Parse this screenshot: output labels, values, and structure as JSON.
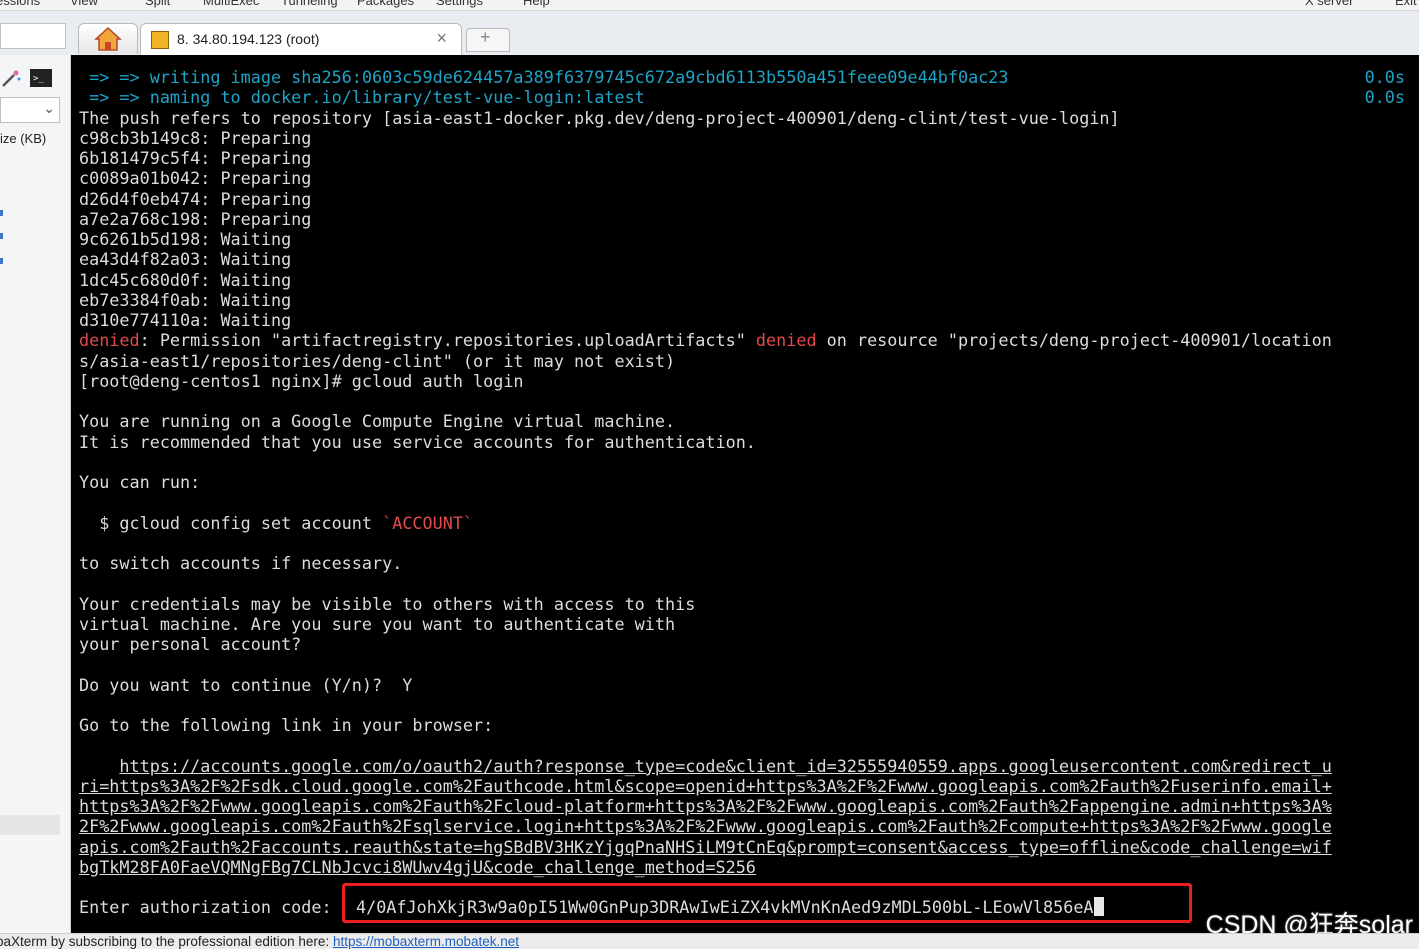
{
  "menu": {
    "items": [
      "essions",
      "View",
      "Split",
      "MultiExec",
      "Tunneling",
      "Packages",
      "Settings",
      "Help"
    ],
    "right_items": [
      "X server",
      "Exit"
    ]
  },
  "tabs": {
    "home_icon": "home-icon",
    "session_title": "8. 34.80.194.123 (root)",
    "close_glyph": "×",
    "new_tab_glyph": "+"
  },
  "sidebar": {
    "column_header": "ize (KB)"
  },
  "terminal": {
    "lines": [
      {
        "cls": "cyan",
        "text": " => => writing image sha256:0603c59de624457a389f6379745c672a9cbd6113b550a451feee09e44bf0ac23"
      },
      {
        "cls": "cyan",
        "text": " => => naming to docker.io/library/test-vue-login:latest"
      },
      {
        "cls": "",
        "text": "The push refers to repository [asia-east1-docker.pkg.dev/deng-project-400901/deng-clint/test-vue-login]"
      },
      {
        "cls": "",
        "text": "c98cb3b149c8: Preparing"
      },
      {
        "cls": "",
        "text": "6b181479c5f4: Preparing"
      },
      {
        "cls": "",
        "text": "c0089a01b042: Preparing"
      },
      {
        "cls": "",
        "text": "d26d4f0eb474: Preparing"
      },
      {
        "cls": "",
        "text": "a7e2a768c198: Preparing"
      },
      {
        "cls": "",
        "text": "9c6261b5d198: Waiting"
      },
      {
        "cls": "",
        "text": "ea43d4f82a03: Waiting"
      },
      {
        "cls": "",
        "text": "1dc45c680d0f: Waiting"
      },
      {
        "cls": "",
        "text": "eb7e3384f0ab: Waiting"
      },
      {
        "cls": "",
        "text": "d310e774110a: Waiting"
      },
      {
        "cls": "denied",
        "text": ": Permission \"artifactregistry.repositories.uploadArtifacts\" ",
        "tail": " on resource \"projects/deng-project-400901/location"
      },
      {
        "cls": "",
        "text": "s/asia-east1/repositories/deng-clint\" (or it may not exist)"
      },
      {
        "cls": "",
        "text": "[root@deng-centos1 nginx]# gcloud auth login"
      },
      {
        "cls": "",
        "text": ""
      },
      {
        "cls": "",
        "text": "You are running on a Google Compute Engine virtual machine."
      },
      {
        "cls": "",
        "text": "It is recommended that you use service accounts for authentication."
      },
      {
        "cls": "",
        "text": ""
      },
      {
        "cls": "",
        "text": "You can run:"
      },
      {
        "cls": "",
        "text": ""
      },
      {
        "cls": "account",
        "text": "  $ gcloud config set account ",
        "tail": "`ACCOUNT`"
      },
      {
        "cls": "",
        "text": ""
      },
      {
        "cls": "",
        "text": "to switch accounts if necessary."
      },
      {
        "cls": "",
        "text": ""
      },
      {
        "cls": "",
        "text": "Your credentials may be visible to others with access to this"
      },
      {
        "cls": "",
        "text": "virtual machine. Are you sure you want to authenticate with"
      },
      {
        "cls": "",
        "text": "your personal account?"
      },
      {
        "cls": "",
        "text": ""
      },
      {
        "cls": "",
        "text": "Do you want to continue (Y/n)?  Y"
      },
      {
        "cls": "",
        "text": ""
      },
      {
        "cls": "",
        "text": "Go to the following link in your browser:"
      },
      {
        "cls": "",
        "text": ""
      },
      {
        "cls": "url",
        "indent": "    ",
        "text": "https://accounts.google.com/o/oauth2/auth?response_type=code&client_id=32555940559.apps.googleusercontent.com&redirect_u"
      },
      {
        "cls": "url",
        "text": "ri=https%3A%2F%2Fsdk.cloud.google.com%2Fauthcode.html&scope=openid+https%3A%2F%2Fwww.googleapis.com%2Fauth%2Fuserinfo.email+"
      },
      {
        "cls": "url",
        "text": "https%3A%2F%2Fwww.googleapis.com%2Fauth%2Fcloud-platform+https%3A%2F%2Fwww.googleapis.com%2Fauth%2Fappengine.admin+https%3A%"
      },
      {
        "cls": "url",
        "text": "2F%2Fwww.googleapis.com%2Fauth%2Fsqlservice.login+https%3A%2F%2Fwww.googleapis.com%2Fauth%2Fcompute+https%3A%2F%2Fwww.google"
      },
      {
        "cls": "url",
        "text": "apis.com%2Fauth%2Faccounts.reauth&state=hgSBdBV3HKzYjgqPnaNHSiLM9tCnEq&prompt=consent&access_type=offline&code_challenge=wif"
      },
      {
        "cls": "url",
        "text": "bgTkM28FA0FaeVQMNgFBg7CLNbJcvci8WUwv4gjU&code_challenge_method=S256"
      },
      {
        "cls": "",
        "text": ""
      },
      {
        "cls": "",
        "text": "Enter authorization code:"
      }
    ],
    "denied_word": "denied",
    "times": [
      "0.0s",
      "0.0s"
    ],
    "auth_code": "4/0AfJohXkjR3w9a0pI51Ww0GnPup3DRAwIwEiZX4vkMVnKnAed9zMDL500bL-LEowVl856eA"
  },
  "watermark": "CSDN @狂奔solar",
  "statusbar": {
    "message": "baXterm by subscribing to the professional edition here: ",
    "link": "https://mobaxterm.mobatek.net"
  },
  "colors": {
    "terminal_bg": "#000000",
    "terminal_fg": "#dcdcdc",
    "cyan": "#1fa3c7",
    "red": "#e04a4a",
    "highlight_box": "#e8201f"
  }
}
